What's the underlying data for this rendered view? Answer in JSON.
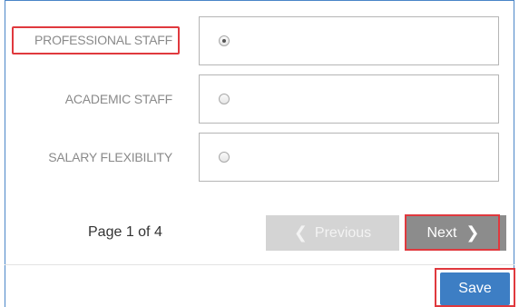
{
  "options": [
    {
      "label": "PROFESSIONAL STAFF",
      "checked": true
    },
    {
      "label": "ACADEMIC STAFF",
      "checked": false
    },
    {
      "label": "SALARY FLEXIBILITY",
      "checked": false
    }
  ],
  "pagination": {
    "info": "Page 1 of 4",
    "previous_label": "Previous",
    "next_label": "Next"
  },
  "footer": {
    "save_label": "Save"
  },
  "colors": {
    "highlight": "#e0393e",
    "save": "#3d7ec4",
    "frame": "#4a86c8"
  },
  "icons": {
    "previous": "chevron-left-icon",
    "next": "chevron-right-icon"
  }
}
